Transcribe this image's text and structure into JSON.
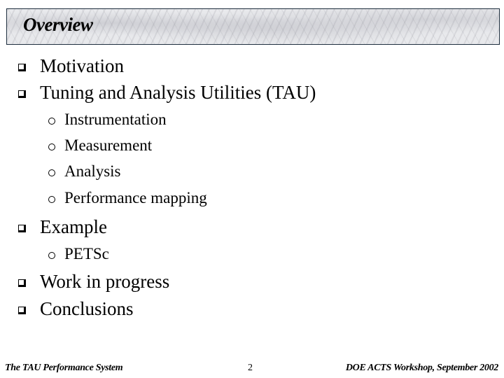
{
  "slide": {
    "title": "Overview",
    "bullets": [
      {
        "text": "Motivation",
        "level": 1
      },
      {
        "text": "Tuning and Analysis Utilities (TAU)",
        "level": 1
      },
      {
        "text": "Instrumentation",
        "level": 2
      },
      {
        "text": "Measurement",
        "level": 2
      },
      {
        "text": "Analysis",
        "level": 2
      },
      {
        "text": "Performance mapping",
        "level": 2
      },
      {
        "text": "Example",
        "level": 1
      },
      {
        "text": "PETSc",
        "level": 2
      },
      {
        "text": "Work in progress",
        "level": 1
      },
      {
        "text": "Conclusions",
        "level": 1
      }
    ],
    "bullet_icons": {
      "level1": "hollow-square-icon",
      "level2": "hollow-circle-icon"
    }
  },
  "footer": {
    "left": "The TAU Performance System",
    "page_number": "2",
    "right": "DOE ACTS Workshop, September 2002"
  }
}
